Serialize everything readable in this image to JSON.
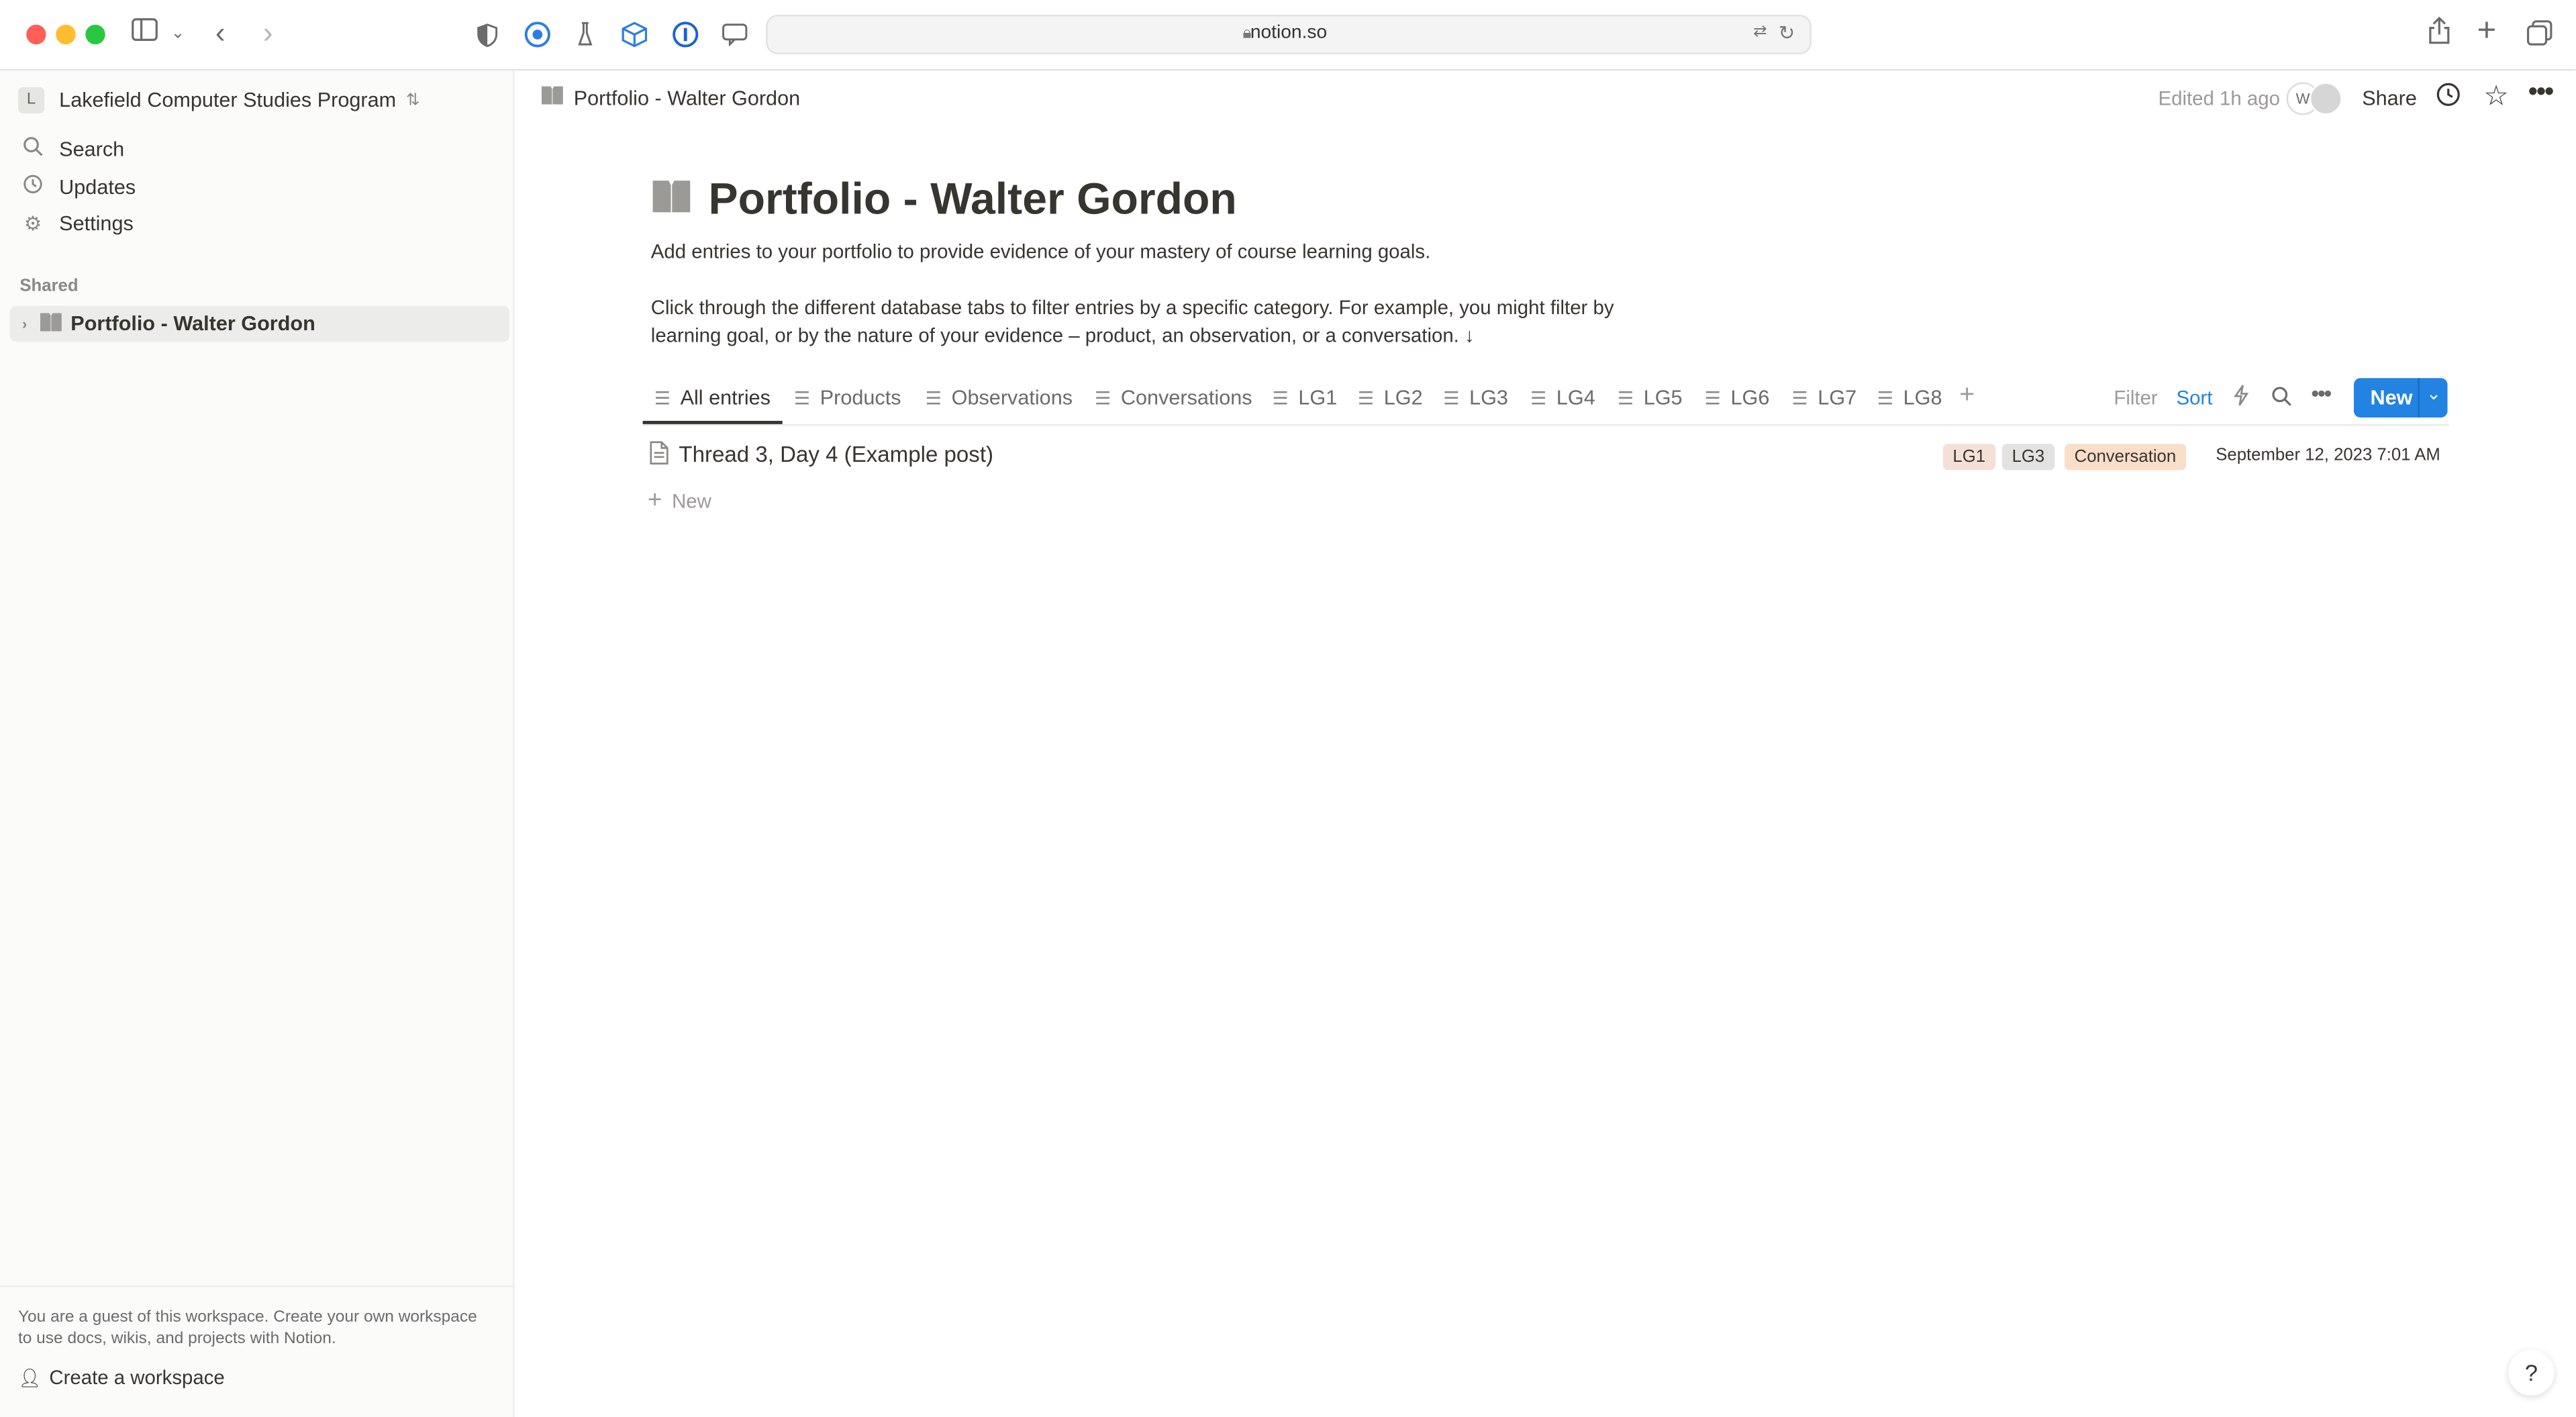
{
  "browser": {
    "url": "notion.so",
    "traffic_colors": [
      "#ff5f57",
      "#febc2e",
      "#28c840"
    ]
  },
  "sidebar": {
    "workspace_initial": "L",
    "workspace_name": "Lakefield Computer Studies Program",
    "items": [
      {
        "label": "Search",
        "icon": "search-icon"
      },
      {
        "label": "Updates",
        "icon": "clock-icon"
      },
      {
        "label": "Settings",
        "icon": "gear-icon"
      }
    ],
    "section_label": "Shared",
    "shared_page": "Portfolio - Walter Gordon",
    "guest_message": "You are a guest of this workspace. Create your own workspace to use docs, wikis, and projects with Notion.",
    "create_workspace": "Create a workspace"
  },
  "topbar": {
    "breadcrumb": "Portfolio - Walter Gordon",
    "edited": "Edited 1h ago",
    "avatar_initial": "W",
    "share": "Share"
  },
  "page": {
    "title": "Portfolio - Walter Gordon",
    "description_1": "Add entries to your portfolio to provide evidence of your mastery of course learning goals.",
    "description_2": "Click through the different database tabs to filter entries by a specific category. For example, you might filter by learning goal, or by the nature of your evidence – product, an observation, or a conversation. ↓"
  },
  "database": {
    "tabs": [
      "All entries",
      "Products",
      "Observations",
      "Conversations",
      "LG1",
      "LG2",
      "LG3",
      "LG4",
      "LG5",
      "LG6",
      "LG7",
      "LG8"
    ],
    "active_tab": "All entries",
    "filter": "Filter",
    "sort": "Sort",
    "new_button": "New",
    "accent_color": "#2383e2",
    "rows": [
      {
        "name": "Thread 3, Day 4 (Example post)",
        "tags": [
          {
            "label": "LG1",
            "color": "#f5e0d8"
          },
          {
            "label": "LG3",
            "color": "#e3e2e0"
          },
          {
            "label": "Conversation",
            "color": "#fadec9"
          }
        ],
        "date": "September 12, 2023 7:01 AM"
      }
    ],
    "add_new": "New"
  },
  "help": "?"
}
